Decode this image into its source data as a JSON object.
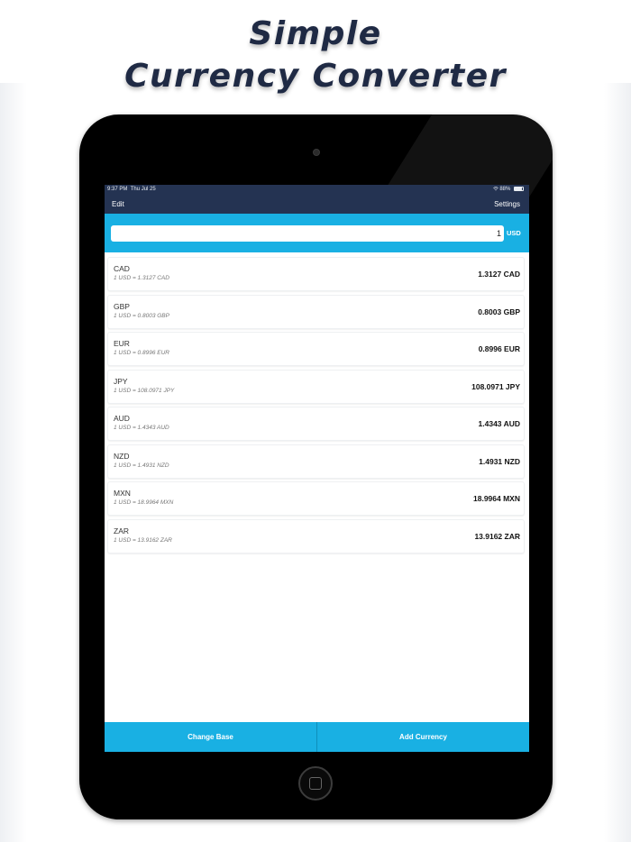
{
  "promo": {
    "line1": "Simple",
    "line2": "Currency Converter"
  },
  "status_bar": {
    "time": "9:37 PM",
    "date": "Thu Jul 25",
    "battery": "88%",
    "battery_level": 0.88
  },
  "nav": {
    "edit_label": "Edit",
    "settings_label": "Settings"
  },
  "converter": {
    "amount": "1",
    "base_currency": "USD"
  },
  "rates": [
    {
      "code": "CAD",
      "rate_text": "1 USD = 1.3127 CAD",
      "converted": "1.3127 CAD"
    },
    {
      "code": "GBP",
      "rate_text": "1 USD = 0.8003 GBP",
      "converted": "0.8003 GBP"
    },
    {
      "code": "EUR",
      "rate_text": "1 USD = 0.8996 EUR",
      "converted": "0.8996 EUR"
    },
    {
      "code": "JPY",
      "rate_text": "1 USD = 108.0971 JPY",
      "converted": "108.0971 JPY"
    },
    {
      "code": "AUD",
      "rate_text": "1 USD = 1.4343 AUD",
      "converted": "1.4343 AUD"
    },
    {
      "code": "NZD",
      "rate_text": "1 USD = 1.4931 NZD",
      "converted": "1.4931 NZD"
    },
    {
      "code": "MXN",
      "rate_text": "1 USD = 18.9964 MXN",
      "converted": "18.9964 MXN"
    },
    {
      "code": "ZAR",
      "rate_text": "1 USD = 13.9162 ZAR",
      "converted": "13.9162 ZAR"
    }
  ],
  "bottom_bar": {
    "change_base_label": "Change Base",
    "add_currency_label": "Add Currency"
  },
  "colors": {
    "accent": "#19b0e3",
    "nav_background": "#243352",
    "headline": "#1f2a44"
  },
  "icons": {
    "status": [
      "wifi-icon",
      "battery-icon"
    ],
    "device": [
      "camera-icon",
      "home-button-icon"
    ]
  }
}
